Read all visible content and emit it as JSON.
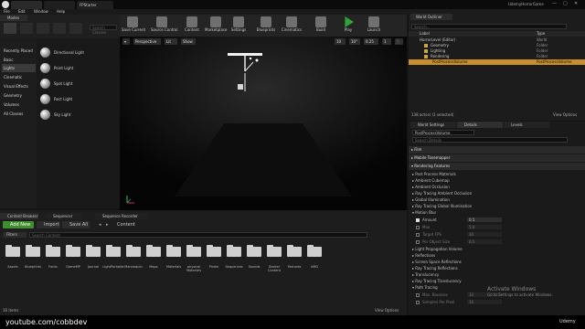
{
  "titlebar": {
    "tab1": "",
    "tab2": "",
    "tab3": "FPStarter",
    "project": "UdemyHorrorGame"
  },
  "menu": [
    "File",
    "Edit",
    "Window",
    "Help"
  ],
  "modes": {
    "title": "Modes"
  },
  "toolbar": [
    {
      "label": "Save Current"
    },
    {
      "label": "Source Control"
    },
    {
      "label": "Content"
    },
    {
      "label": "Marketplace"
    },
    {
      "label": "Settings"
    },
    {
      "label": "Blueprints"
    },
    {
      "label": "Cinematics"
    },
    {
      "label": "Build"
    },
    {
      "label": "Play"
    },
    {
      "label": "Launch"
    }
  ],
  "place": {
    "search_placeholder": "Search Classes",
    "categories": [
      "Recently Placed",
      "Basic",
      "Lights",
      "Cinematic",
      "Visual Effects",
      "Geometry",
      "Volumes",
      "All Classes"
    ],
    "selected_category": "Lights",
    "items": [
      "Directional Light",
      "Point Light",
      "Spot Light",
      "Rect Light",
      "Sky Light"
    ]
  },
  "viewport": {
    "perspective": "Perspective",
    "lit": "Lit",
    "show": "Show",
    "grid": "10",
    "angle": "10°",
    "scale": "0.25",
    "speed": "1"
  },
  "outliner": {
    "title": "World Outliner",
    "search_placeholder": "Search...",
    "col_label": "Label",
    "col_type": "Type",
    "rows": [
      {
        "label": "HorrorLevel (Editor)",
        "type": "World"
      },
      {
        "label": "Geometry",
        "type": "Folder"
      },
      {
        "label": "Lighting",
        "type": "Folder"
      },
      {
        "label": "Rendering",
        "type": "Folder"
      },
      {
        "label": "PostProcessVolume",
        "type": "PostProcessVolume"
      }
    ],
    "footer": "138 actors (1 selected)",
    "view_options": "View Options"
  },
  "details": {
    "tabs": [
      "World Settings",
      "Details",
      "Levels"
    ],
    "name_value": "PostProcessVolume",
    "search_placeholder": "Search Details",
    "sections": [
      "Film",
      "Mobile Tonemapper",
      "Rendering Features"
    ],
    "rendering_items": [
      "Post Process Materials",
      "Ambient Cubemap",
      "Ambient Occlusion",
      "Ray Tracing Ambient Occlusion",
      "Global Illumination",
      "Ray Tracing Global Illumination",
      "Motion Blur"
    ],
    "motion_blur": [
      {
        "label": "Amount",
        "value": "0.5",
        "checked": true
      },
      {
        "label": "Max",
        "value": "5.0",
        "checked": false
      },
      {
        "label": "Target FPS",
        "value": "30",
        "checked": false
      },
      {
        "label": "Per Object Size",
        "value": "0.5",
        "checked": false
      }
    ],
    "more_items": [
      "Light Propagation Volume",
      "Reflections",
      "Screen Space Reflections",
      "Ray Tracing Reflections",
      "Translucency",
      "Ray Tracing Translucency",
      "Path Tracing"
    ],
    "path_tracing": [
      {
        "label": "Max. Bounces",
        "value": "32"
      },
      {
        "label": "Samples Per Pixel",
        "value": "16"
      }
    ]
  },
  "content_browser": {
    "tabs": [
      "Content Browser",
      "Sequencer",
      "Sequence Recorder"
    ],
    "add_new": "Add New",
    "import": "Import",
    "save_all": "Save All",
    "path": "Content",
    "filters": "Filters",
    "search_placeholder": "Search Content",
    "folders": [
      "Assets",
      "Blueprints",
      "Fonts",
      "GameMP",
      "Journal",
      "LightPortable",
      "Mannequin",
      "Maps",
      "Materials",
      "physical Materials",
      "Pirate",
      "Sequences",
      "Sounds",
      "Starter Content",
      "Textures",
      "UMG"
    ],
    "footer": "16 items",
    "view_options": "View Options"
  },
  "activation": {
    "title": "Activate Windows",
    "subtitle": "Go to Settings to activate Windows."
  },
  "watermark": {
    "left": "youtube.com/cobbdev",
    "right": "Udemy"
  }
}
